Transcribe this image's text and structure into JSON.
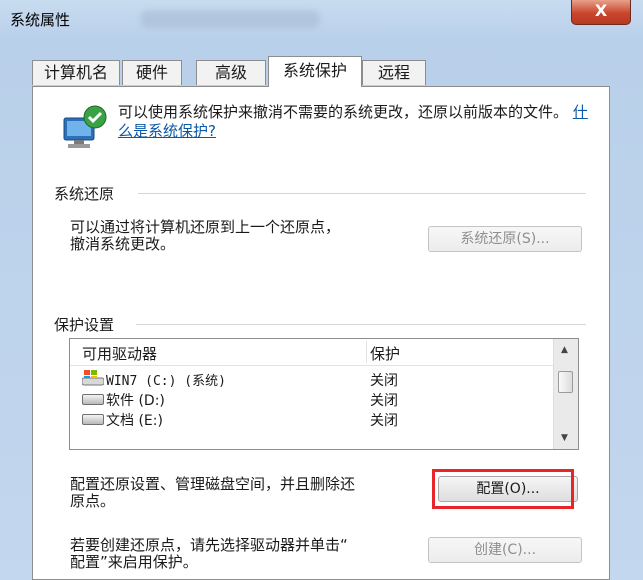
{
  "window": {
    "title": "系统属性",
    "close_label": "X"
  },
  "tabs": [
    {
      "label": "计算机名"
    },
    {
      "label": "硬件"
    },
    {
      "label": "高级"
    },
    {
      "label": "系统保护",
      "active": true
    },
    {
      "label": "远程"
    }
  ],
  "intro": {
    "text": "可以使用系统保护来撤消不需要的系统更改，还原以前版本的文件。",
    "link": "什么是系统保护?"
  },
  "restore": {
    "section": "系统还原",
    "desc_line1": "可以通过将计算机还原到上一个还原点，",
    "desc_line2": "撤消系统更改。",
    "button": "系统还原(S)..."
  },
  "protection": {
    "section": "保护设置",
    "col_drive": "可用驱动器",
    "col_protect": "保护",
    "drives": [
      {
        "name": "WIN7 (C:) (系统)",
        "status": "关闭",
        "icon": "windows-drive-icon"
      },
      {
        "name": "软件 (D:)",
        "status": "关闭",
        "icon": "drive-icon"
      },
      {
        "name": "文档 (E:)",
        "status": "关闭",
        "icon": "drive-icon"
      }
    ],
    "config_desc_line1": "配置还原设置、管理磁盘空间，并且删除还",
    "config_desc_line2": "原点。",
    "config_button": "配置(O)...",
    "create_desc_line1": "若要创建还原点，请先选择驱动器并单击“",
    "create_desc_line2": "配置”来启用保护。",
    "create_button": "创建(C)..."
  },
  "colors": {
    "highlight": "#e8262a",
    "link": "#0b57a8"
  }
}
